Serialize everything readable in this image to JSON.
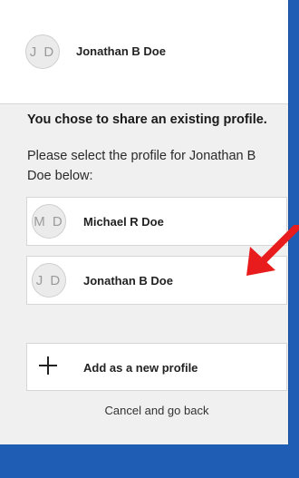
{
  "header": {
    "avatar_initials": "J D",
    "name": "Jonathan B Doe"
  },
  "main": {
    "heading": "You chose to share an existing profile.",
    "instructions": "Please select the profile for Jonathan B Doe below:"
  },
  "profiles": [
    {
      "initials": "M D",
      "name": "Michael R Doe"
    },
    {
      "initials": "J D",
      "name": "Jonathan B Doe"
    }
  ],
  "actions": {
    "add_label": "Add as a new profile",
    "cancel_label": "Cancel and go back"
  },
  "annotation": {
    "arrow_color": "#e81c1c",
    "arrow_icon": "red-arrow-pointing-left-down"
  },
  "colors": {
    "background_blue": "#1f5db5",
    "panel": "#f0f0f0"
  }
}
